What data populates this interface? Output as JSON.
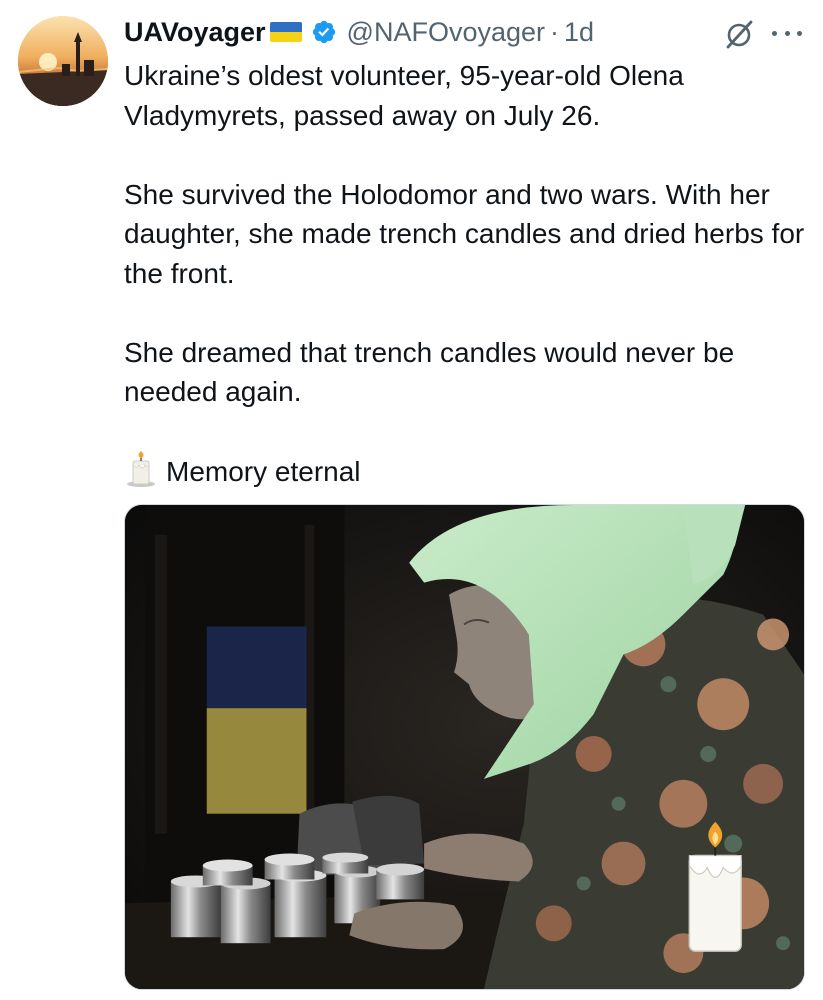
{
  "tweet": {
    "author": {
      "display_name": "UAVoyager",
      "handle": "@NAFOvoyager",
      "separator": "·",
      "time": "1d",
      "avatar_icon": "avatar-sunset-city",
      "flag_icon": "ukraine-flag-icon",
      "verified_icon": "verified-badge-icon"
    },
    "actions": {
      "grok_icon": "grok-icon",
      "more_icon": "more-options-icon"
    },
    "paragraphs": [
      "Ukraine’s oldest volunteer, 95-year-old Olena Vladymyrets, passed away on July 26.",
      "She survived the Holodomor and two wars. With her daughter, she made trench candles and dried herbs for the front.",
      "She dreamed that trench candles would never be needed again.",
      "Memory eternal"
    ],
    "media": {
      "icon": "photo-elderly-woman-trench-candles"
    },
    "colors": {
      "text": "#0f1419",
      "secondary": "#536471",
      "verified": "#1d9bf0",
      "flag_blue": "#2f6fc4",
      "flag_yellow": "#f7d114"
    }
  }
}
